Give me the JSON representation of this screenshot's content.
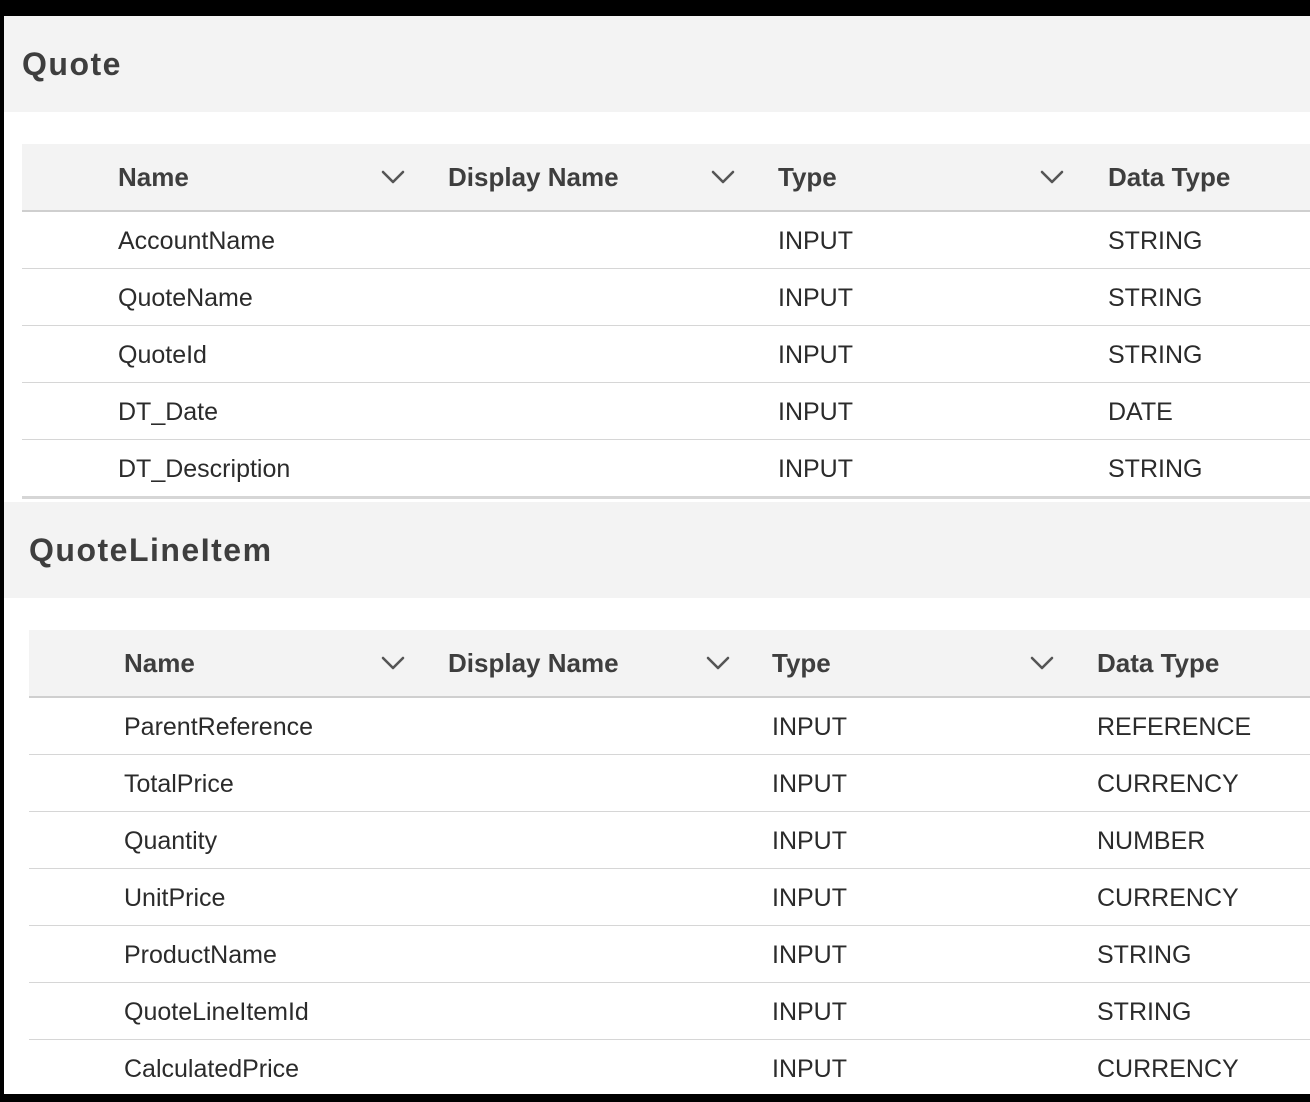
{
  "sections": [
    {
      "title": "Quote",
      "headers": [
        "Name",
        "Display Name",
        "Type",
        "Data Type"
      ],
      "rows": [
        {
          "name": "AccountName",
          "display_name": "",
          "type": "INPUT",
          "data_type": "STRING"
        },
        {
          "name": "QuoteName",
          "display_name": "",
          "type": "INPUT",
          "data_type": "STRING"
        },
        {
          "name": "QuoteId",
          "display_name": "",
          "type": "INPUT",
          "data_type": "STRING"
        },
        {
          "name": "DT_Date",
          "display_name": "",
          "type": "INPUT",
          "data_type": "DATE"
        },
        {
          "name": "DT_Description",
          "display_name": "",
          "type": "INPUT",
          "data_type": "STRING"
        }
      ]
    },
    {
      "title": "QuoteLineItem",
      "headers": [
        "Name",
        "Display Name",
        "Type",
        "Data Type"
      ],
      "rows": [
        {
          "name": "ParentReference",
          "display_name": "",
          "type": "INPUT",
          "data_type": "REFERENCE"
        },
        {
          "name": "TotalPrice",
          "display_name": "",
          "type": "INPUT",
          "data_type": "CURRENCY"
        },
        {
          "name": "Quantity",
          "display_name": "",
          "type": "INPUT",
          "data_type": "NUMBER"
        },
        {
          "name": "UnitPrice",
          "display_name": "",
          "type": "INPUT",
          "data_type": "CURRENCY"
        },
        {
          "name": "ProductName",
          "display_name": "",
          "type": "INPUT",
          "data_type": "STRING"
        },
        {
          "name": "QuoteLineItemId",
          "display_name": "",
          "type": "INPUT",
          "data_type": "STRING"
        },
        {
          "name": "CalculatedPrice",
          "display_name": "",
          "type": "INPUT",
          "data_type": "CURRENCY"
        }
      ]
    }
  ],
  "icons": {
    "sort": "chevron-down-icon"
  }
}
